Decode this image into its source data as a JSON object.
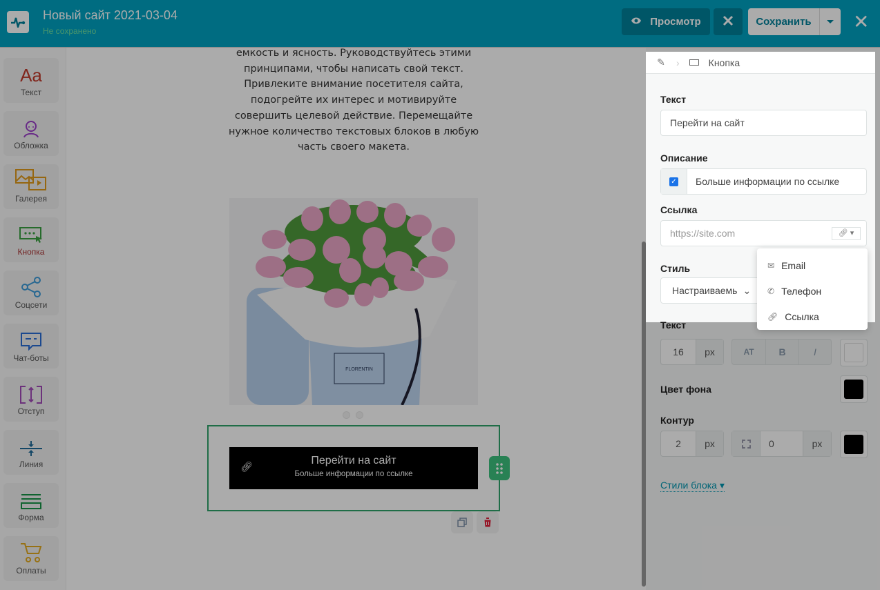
{
  "header": {
    "title": "Новый сайт 2021-03-04",
    "status": "Не сохранено",
    "preview_label": "Просмотр",
    "save_label": "Сохранить"
  },
  "sidebar": {
    "items": [
      {
        "label": "Текст",
        "glyph": "Aa"
      },
      {
        "label": "Обложка"
      },
      {
        "label": "Галерея"
      },
      {
        "label": "Кнопка"
      },
      {
        "label": "Соцсети"
      },
      {
        "label": "Чат-боты"
      },
      {
        "label": "Отступ"
      },
      {
        "label": "Линия"
      },
      {
        "label": "Форма"
      },
      {
        "label": "Оплаты"
      }
    ]
  },
  "canvas": {
    "paragraph": "емкость и ясность. Руководствуйтесь этими принципами, чтобы написать свой текст. Привлеките внимание посетителя сайта, подогрейте их интерес и мотивируйте совершить целевой действие. Перемещайте нужное количество текстовых блоков в любую часть своего макета.",
    "image_logo_text": "FLORENTIN",
    "button": {
      "text": "Перейти на сайт",
      "description": "Больше информации по ссылке",
      "bg_color": "#000000"
    }
  },
  "panel": {
    "breadcrumb": "Кнопка",
    "text_label": "Текст",
    "text_value": "Перейти на сайт",
    "desc_label": "Описание",
    "desc_checked": true,
    "desc_value": "Больше информации по ссылке",
    "link_label": "Ссылка",
    "link_placeholder": "https://site.com",
    "link_menu": [
      {
        "label": "Email",
        "icon": "mail-icon"
      },
      {
        "label": "Телефон",
        "icon": "phone-icon"
      },
      {
        "label": "Ссылка",
        "icon": "link-icon"
      }
    ],
    "style_label": "Стиль",
    "style_value": "Настраиваемь",
    "font_label": "Текст",
    "font_size": "16",
    "unit": "px",
    "caps": "AT",
    "bold": "B",
    "italic": "I",
    "text_color": "#ffffff",
    "bg_label": "Цвет фона",
    "bg_color": "#000000",
    "border_label": "Контур",
    "border_width": "2",
    "radius": "0",
    "border_color": "#000000",
    "block_styles": "Стили блока"
  }
}
